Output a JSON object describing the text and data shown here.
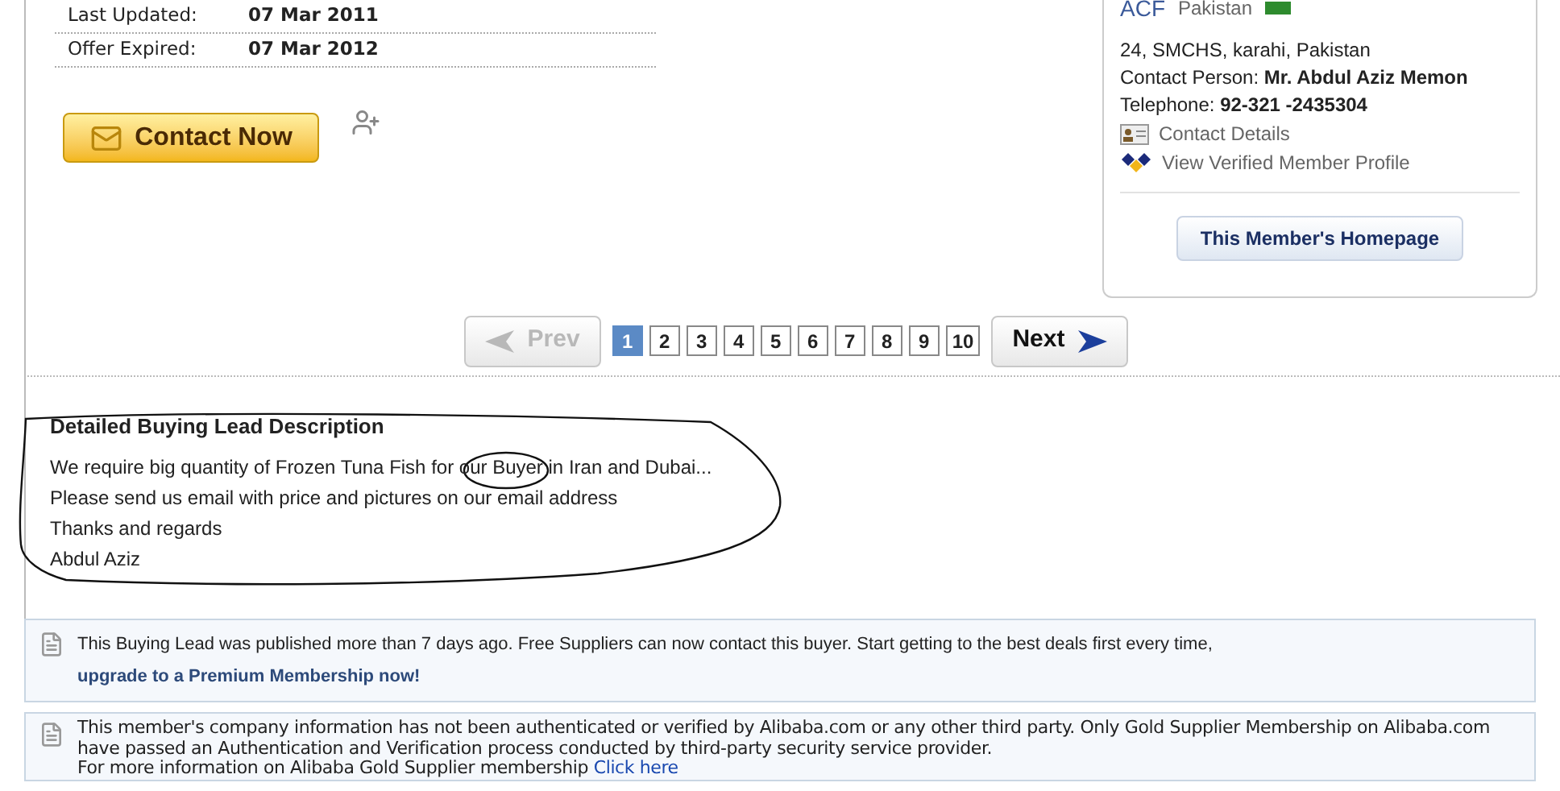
{
  "details": [
    {
      "label": "Last Updated:",
      "value": "07 Mar 2011"
    },
    {
      "label": "Offer Expired:",
      "value": "07 Mar 2012"
    }
  ],
  "contact_button": "Contact Now",
  "supplier": {
    "name": "ACF",
    "country": "Pakistan",
    "address": "24, SMCHS, karahi, Pakistan",
    "contact_person_label": "Contact Person:",
    "contact_person": "Mr. Abdul Aziz Memon",
    "telephone_label": "Telephone:",
    "telephone": "92-321 -2435304",
    "links": [
      "Contact Details",
      "View Verified Member Profile"
    ],
    "homepage_button": "This Member's Homepage"
  },
  "pagination": {
    "prev": {
      "label": "Prev",
      "disabled": true
    },
    "next": {
      "label": "Next",
      "disabled": false
    },
    "pages": [
      {
        "label": "1",
        "selected": true
      },
      {
        "label": "2",
        "selected": false
      },
      {
        "label": "3",
        "selected": false
      },
      {
        "label": "4",
        "selected": false
      },
      {
        "label": "5",
        "selected": false
      },
      {
        "label": "6",
        "selected": false
      },
      {
        "label": "7",
        "selected": false
      },
      {
        "label": "8",
        "selected": false
      },
      {
        "label": "9",
        "selected": false
      },
      {
        "label": "10",
        "selected": false
      }
    ]
  },
  "description": {
    "title": "Detailed Buying Lead Description",
    "lines": [
      "We require big quantity of Frozen Tuna Fish for our Buyer in Iran and Dubai...",
      "Please send us email with price and pictures on our email address",
      "Thanks and regards",
      "Abdul Aziz"
    ]
  },
  "notices": [
    {
      "text": "This Buying Lead was published more than 7 days ago. Free Suppliers can now contact this buyer. Start getting to the best deals first every time,",
      "link": "upgrade to a Premium Membership now!"
    },
    {
      "text": "This member's company information has not been authenticated or verified by Alibaba.com or any other third party. Only Gold Supplier Membership on Alibaba.com have passed an Authentication and Verification process conducted by third-party security service provider.",
      "more": "For more information on Alibaba Gold Supplier membership",
      "link": "Click here"
    }
  ]
}
